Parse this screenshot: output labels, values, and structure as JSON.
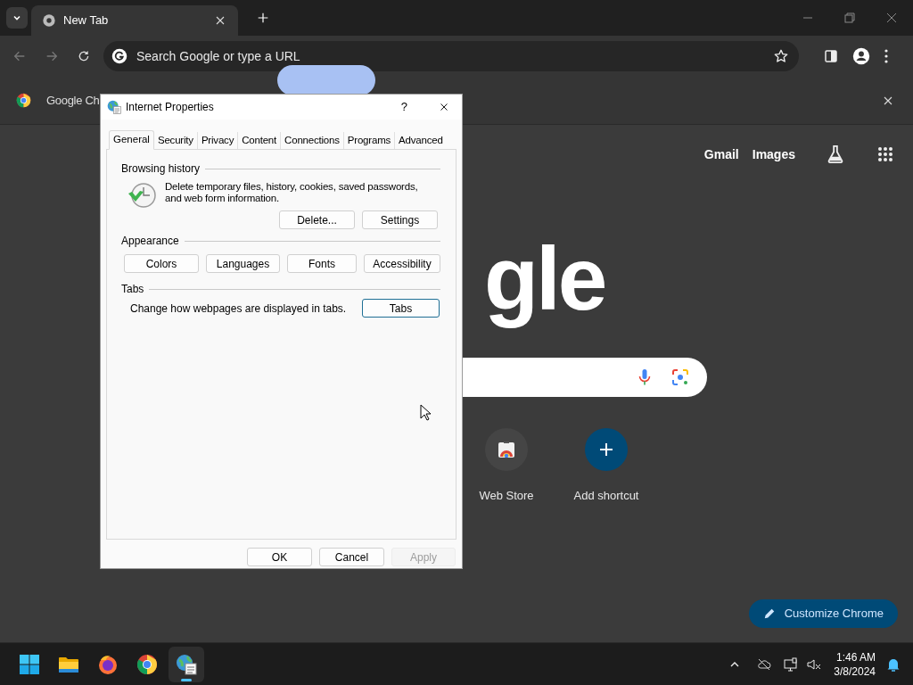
{
  "browser": {
    "tabs": [
      {
        "title": "New Tab",
        "selected": true
      }
    ],
    "address_bar": {
      "placeholder": "Search Google or type a URL"
    },
    "infobar": {
      "text": "Google Ch"
    },
    "new_tab_page": {
      "header_links": [
        "Gmail",
        "Images"
      ],
      "logo": "gle",
      "shortcuts": [
        {
          "kind": "store",
          "label": "Web Store"
        },
        {
          "kind": "add",
          "label": "Add shortcut"
        }
      ],
      "customize_button": "Customize Chrome"
    }
  },
  "dialog": {
    "title": "Internet Properties",
    "help": "?",
    "tabs": [
      {
        "label": "General",
        "selected": true
      },
      {
        "label": "Security",
        "selected": false
      },
      {
        "label": "Privacy",
        "selected": false
      },
      {
        "label": "Content",
        "selected": false
      },
      {
        "label": "Connections",
        "selected": false
      },
      {
        "label": "Programs",
        "selected": false
      },
      {
        "label": "Advanced",
        "selected": false
      }
    ],
    "browsing_history": {
      "heading": "Browsing history",
      "description": "Delete temporary files, history, cookies, saved passwords, and web form information.",
      "buttons": [
        "Delete...",
        "Settings"
      ]
    },
    "appearance": {
      "heading": "Appearance",
      "buttons": [
        "Colors",
        "Languages",
        "Fonts",
        "Accessibility"
      ]
    },
    "tabs_section": {
      "heading": "Tabs",
      "description": "Change how webpages are displayed in tabs.",
      "button": "Tabs"
    },
    "footer_buttons": [
      {
        "label": "OK",
        "disabled": false
      },
      {
        "label": "Cancel",
        "disabled": false
      },
      {
        "label": "Apply",
        "disabled": true
      }
    ]
  },
  "taskbar": {
    "apps": [
      {
        "kind": "start",
        "active": false
      },
      {
        "kind": "explorer",
        "active": false
      },
      {
        "kind": "firefox",
        "active": false
      },
      {
        "kind": "chrome",
        "active": false
      },
      {
        "kind": "properties",
        "active": true
      }
    ],
    "time": "1:46 AM",
    "date": "3/8/2024"
  }
}
